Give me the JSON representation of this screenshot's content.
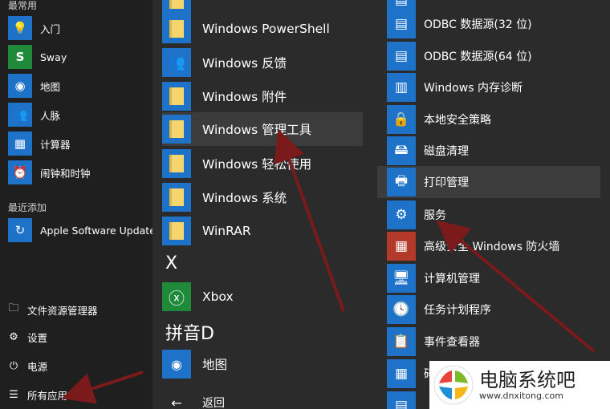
{
  "left": {
    "frequent_label": "最常用",
    "recent_label": "最近添加",
    "frequent": [
      {
        "label": "入门",
        "icon": "lightbulb-icon",
        "glyph": "💡"
      },
      {
        "label": "Sway",
        "icon": "sway-icon",
        "glyph": "S"
      },
      {
        "label": "地图",
        "icon": "maps-icon",
        "glyph": "◉"
      },
      {
        "label": "人脉",
        "icon": "people-icon",
        "glyph": "👥"
      },
      {
        "label": "计算器",
        "icon": "calculator-icon",
        "glyph": "▦"
      },
      {
        "label": "闹钟和时钟",
        "icon": "alarm-clock-icon",
        "glyph": "⏰"
      }
    ],
    "recent": [
      {
        "label": "Apple Software Update",
        "icon": "apple-update-icon",
        "glyph": "↻"
      }
    ],
    "system": [
      {
        "label": "文件资源管理器",
        "icon": "file-explorer-icon",
        "glyph": "🗀"
      },
      {
        "label": "设置",
        "icon": "gear-icon",
        "glyph": "⚙"
      },
      {
        "label": "电源",
        "icon": "power-icon",
        "glyph": "⏻"
      },
      {
        "label": "所有应用",
        "icon": "list-icon",
        "glyph": "☰"
      }
    ]
  },
  "middle": {
    "items": [
      {
        "label": "Windows PowerShell",
        "icon": "folder-icon"
      },
      {
        "label": "Windows 反馈",
        "icon": "feedback-icon"
      },
      {
        "label": "Windows 附件",
        "icon": "folder-icon"
      },
      {
        "label": "Windows 管理工具",
        "icon": "folder-icon"
      },
      {
        "label": "Windows 轻松使用",
        "icon": "folder-icon"
      },
      {
        "label": "Windows 系统",
        "icon": "folder-icon"
      },
      {
        "label": "WinRAR",
        "icon": "folder-icon"
      }
    ],
    "letter_x": "X",
    "xbox": "Xbox",
    "letter_pinyin": "拼音D",
    "maps": "地图",
    "back": "返回"
  },
  "right": {
    "items": [
      {
        "label": "ODBC 数据源(32 位)",
        "icon": "odbc-icon",
        "glyph": "▤"
      },
      {
        "label": "ODBC 数据源(64 位)",
        "icon": "odbc-icon",
        "glyph": "▤"
      },
      {
        "label": "Windows 内存诊断",
        "icon": "memory-diagnostic-icon",
        "glyph": "▥"
      },
      {
        "label": "本地安全策略",
        "icon": "security-policy-icon",
        "glyph": "🔒"
      },
      {
        "label": "磁盘清理",
        "icon": "disk-cleanup-icon",
        "glyph": "🖴"
      },
      {
        "label": "打印管理",
        "icon": "print-management-icon",
        "glyph": "🖶"
      },
      {
        "label": "服务",
        "icon": "services-gear-icon",
        "glyph": "⚙"
      },
      {
        "label": "高级安全 Windows 防火墙",
        "icon": "firewall-icon",
        "glyph": "▦"
      },
      {
        "label": "计算机管理",
        "icon": "computer-management-icon",
        "glyph": "🖥"
      },
      {
        "label": "任务计划程序",
        "icon": "task-scheduler-icon",
        "glyph": "🕓"
      },
      {
        "label": "事件查看器",
        "icon": "event-viewer-icon",
        "glyph": "📋"
      },
      {
        "label": "碎",
        "icon": "defrag-icon",
        "glyph": "▦"
      }
    ]
  },
  "watermark": {
    "title": "电脑系统吧",
    "url": "www.dnxitong.com"
  },
  "colors": {
    "tile_blue": "#1e73c9",
    "arrow_red": "#7a1a1a"
  }
}
